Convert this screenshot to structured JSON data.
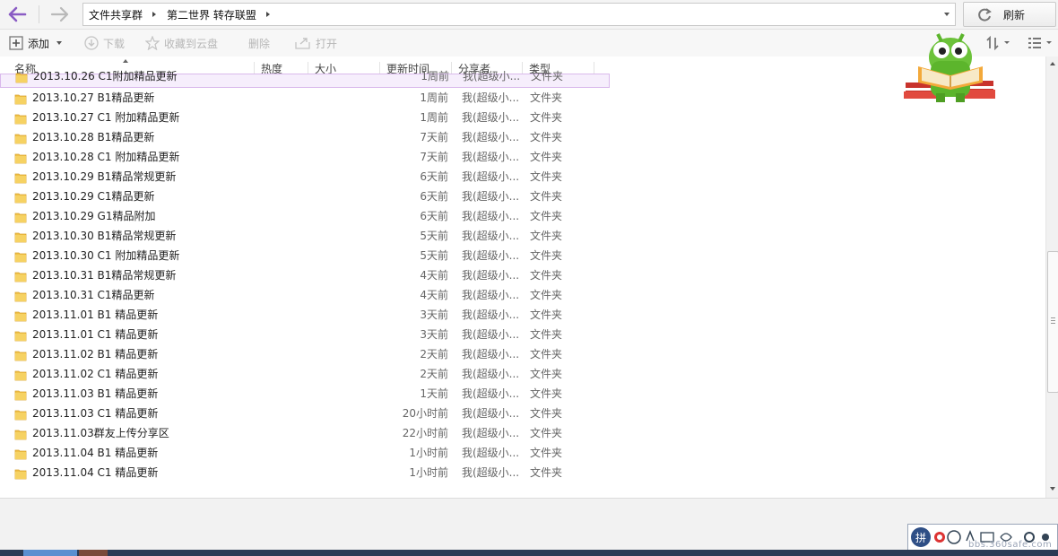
{
  "nav": {
    "breadcrumb": [
      "文件共享群",
      "第二世界 转存联盟"
    ],
    "refresh_label": "刷新"
  },
  "toolbar": {
    "add_label": "添加",
    "download_label": "下载",
    "save_cloud_label": "收藏到云盘",
    "delete_label": "删除",
    "open_label": "打开"
  },
  "columns": {
    "name": "名称",
    "heat": "热度",
    "size": "大小",
    "updated": "更新时间",
    "sharer": "分享者",
    "type": "类型"
  },
  "files": [
    {
      "name": "2013.10.26 C1附加精品更新",
      "time": "1周前",
      "sharer": "我(超级小...",
      "type": "文件夹"
    },
    {
      "name": "2013.10.27 B1精品更新",
      "time": "1周前",
      "sharer": "我(超级小...",
      "type": "文件夹"
    },
    {
      "name": "2013.10.27 C1 附加精品更新",
      "time": "1周前",
      "sharer": "我(超级小...",
      "type": "文件夹"
    },
    {
      "name": "2013.10.28 B1精品更新",
      "time": "7天前",
      "sharer": "我(超级小...",
      "type": "文件夹"
    },
    {
      "name": "2013.10.28 C1 附加精品更新",
      "time": "7天前",
      "sharer": "我(超级小...",
      "type": "文件夹"
    },
    {
      "name": "2013.10.29 B1精品常规更新",
      "time": "6天前",
      "sharer": "我(超级小...",
      "type": "文件夹"
    },
    {
      "name": "2013.10.29 C1精品更新",
      "time": "6天前",
      "sharer": "我(超级小...",
      "type": "文件夹"
    },
    {
      "name": "2013.10.29 G1精品附加",
      "time": "6天前",
      "sharer": "我(超级小...",
      "type": "文件夹"
    },
    {
      "name": "2013.10.30 B1精品常规更新",
      "time": "5天前",
      "sharer": "我(超级小...",
      "type": "文件夹"
    },
    {
      "name": "2013.10.30 C1 附加精品更新",
      "time": "5天前",
      "sharer": "我(超级小...",
      "type": "文件夹"
    },
    {
      "name": "2013.10.31 B1精品常规更新",
      "time": "4天前",
      "sharer": "我(超级小...",
      "type": "文件夹"
    },
    {
      "name": "2013.10.31 C1精品更新",
      "time": "4天前",
      "sharer": "我(超级小...",
      "type": "文件夹"
    },
    {
      "name": "2013.11.01 B1 精品更新",
      "time": "3天前",
      "sharer": "我(超级小...",
      "type": "文件夹"
    },
    {
      "name": "2013.11.01 C1 精品更新",
      "time": "3天前",
      "sharer": "我(超级小...",
      "type": "文件夹"
    },
    {
      "name": "2013.11.02 B1 精品更新",
      "time": "2天前",
      "sharer": "我(超级小...",
      "type": "文件夹"
    },
    {
      "name": "2013.11.02 C1 精品更新",
      "time": "2天前",
      "sharer": "我(超级小...",
      "type": "文件夹"
    },
    {
      "name": "2013.11.03 B1 精品更新",
      "time": "1天前",
      "sharer": "我(超级小...",
      "type": "文件夹"
    },
    {
      "name": "2013.11.03 C1 精品更新",
      "time": "20小时前",
      "sharer": "我(超级小...",
      "type": "文件夹"
    },
    {
      "name": "2013.11.03群友上传分享区",
      "time": "22小时前",
      "sharer": "我(超级小...",
      "type": "文件夹"
    },
    {
      "name": "2013.11.04 B1 精品更新",
      "time": "1小时前",
      "sharer": "我(超级小...",
      "type": "文件夹"
    },
    {
      "name": "2013.11.04 C1 精品更新",
      "time": "1小时前",
      "sharer": "我(超级小...",
      "type": "文件夹"
    }
  ],
  "ime": {
    "label": "拼"
  },
  "watermark": "bbs.360safe.com",
  "colors": {
    "accent": "#8a5cc4",
    "folder": "#f0c24a",
    "selected_bg": "#f6eefc"
  }
}
